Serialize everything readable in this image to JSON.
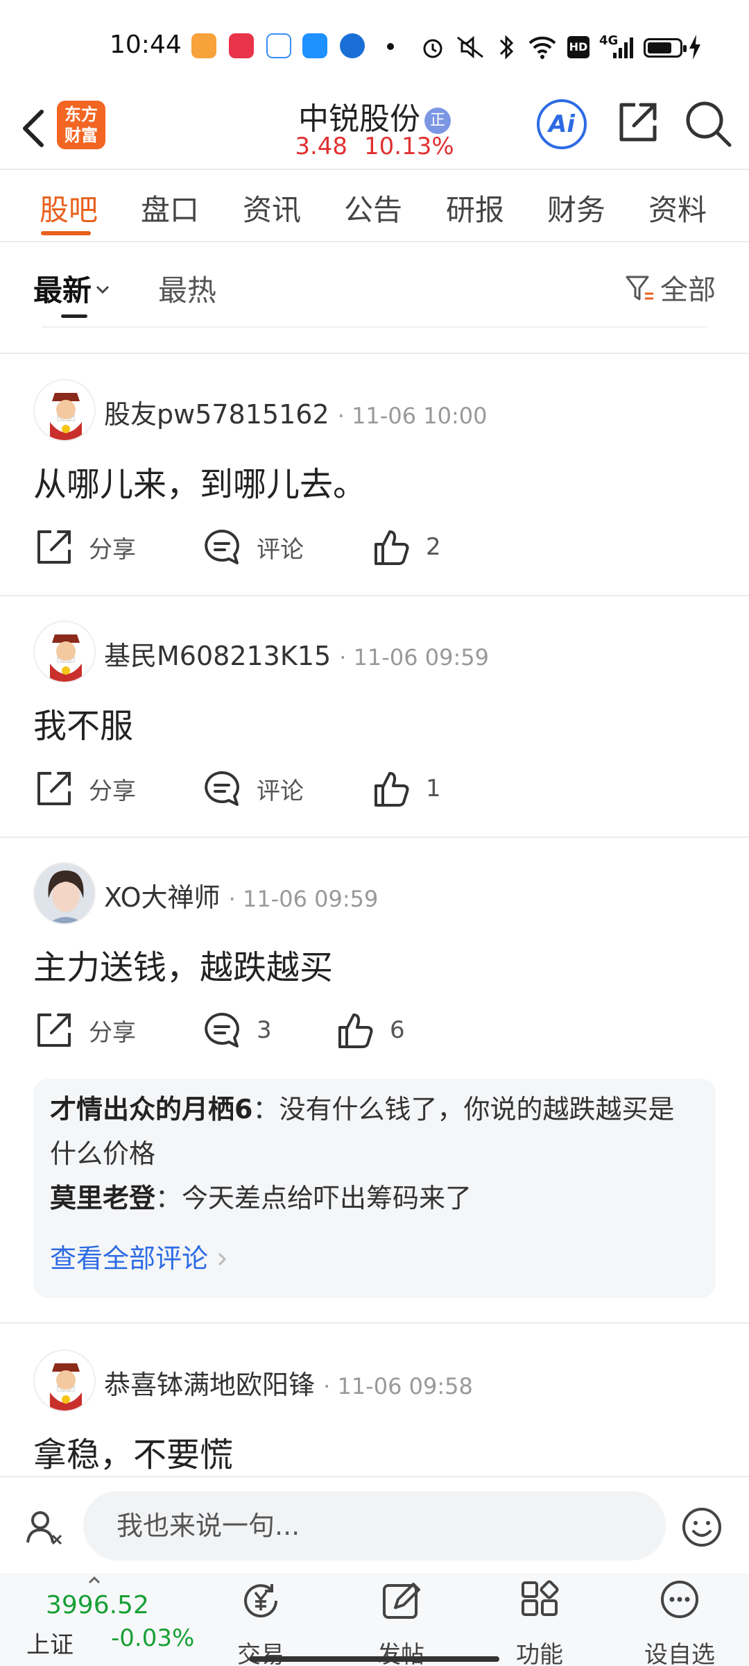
{
  "status_bar": {
    "time": "10:44",
    "app_icons": [
      {
        "name": "app-icon-orange",
        "color": "#f7a23b"
      },
      {
        "name": "app-icon-xiaohongshu",
        "color": "#e8334a"
      },
      {
        "name": "app-icon-search",
        "color": "#3b8df7"
      },
      {
        "name": "app-icon-blue",
        "color": "#1e90ff"
      },
      {
        "name": "app-icon-c",
        "color": "#1a6fd6"
      }
    ],
    "indicators": [
      "alarm-icon",
      "mute-icon",
      "bluetooth-icon",
      "wifi-icon",
      "hd-icon",
      "4g-signal-icon",
      "battery-icon",
      "charging-icon"
    ],
    "hd_label": "HD",
    "network_label": "4G"
  },
  "header": {
    "logo_text": "东方财富",
    "stock_name": "中锐股份",
    "badge": "正",
    "price": "3.48",
    "change_pct": "10.13%",
    "ai_label": "Ai"
  },
  "tabs": [
    {
      "label": "股吧",
      "active": true
    },
    {
      "label": "盘口",
      "active": false
    },
    {
      "label": "资讯",
      "active": false
    },
    {
      "label": "公告",
      "active": false
    },
    {
      "label": "研报",
      "active": false
    },
    {
      "label": "财务",
      "active": false
    },
    {
      "label": "资料",
      "active": false
    }
  ],
  "sort": {
    "latest": "最新",
    "hottest": "最热",
    "filter": "全部"
  },
  "posts": [
    {
      "author": "股友pw57815162",
      "time": "· 11-06 10:00",
      "content": "从哪儿来，到哪儿去。",
      "share": "分享",
      "comment": "评论",
      "likes": "2"
    },
    {
      "author": "基民M608213K15",
      "time": "· 11-06 09:59",
      "content": "我不服",
      "share": "分享",
      "comment": "评论",
      "likes": "1"
    },
    {
      "author": "XO大禅师",
      "time": "· 11-06 09:59",
      "content": "主力送钱，越跌越买",
      "share": "分享",
      "comment": "3",
      "likes": "6",
      "comments": [
        {
          "user": "才情出众的月栖6",
          "text": "：没有什么钱了，你说的越跌越买是什么价格"
        },
        {
          "user": "莫里老登",
          "text": "：今天差点给吓出筹码来了"
        }
      ],
      "view_all": "查看全部评论"
    },
    {
      "author": "恭喜钵满地欧阳锋",
      "time": "· 11-06 09:58",
      "content": "拿稳，不要慌"
    }
  ],
  "input": {
    "placeholder": "我也来说一句..."
  },
  "bottom_nav": {
    "index_value": "3996.52",
    "index_name": "上证",
    "index_change": "-0.03%",
    "items": [
      {
        "label": "交易",
        "icon": "trade-yen-icon"
      },
      {
        "label": "发帖",
        "icon": "compose-icon"
      },
      {
        "label": "功能",
        "icon": "grid-icon"
      },
      {
        "label": "设自选",
        "icon": "more-icon"
      }
    ]
  },
  "colors": {
    "accent": "#e8601c",
    "price_up": "#e03131",
    "price_down": "#17a035",
    "link": "#2d6be4"
  }
}
